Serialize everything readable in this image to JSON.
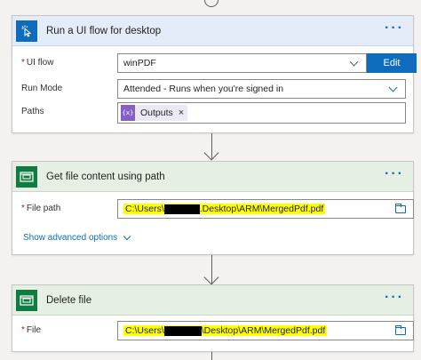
{
  "steps": [
    {
      "title": "Run a UI flow for desktop",
      "more_label": "···",
      "icon": "cursor-click-icon",
      "color": "#0f6cbd",
      "fields": {
        "ui_flow": {
          "label": "UI flow",
          "required": true,
          "value": "winPDF",
          "button": "Edit"
        },
        "run_mode": {
          "label": "Run Mode",
          "value": "Attended - Runs when you're signed in"
        },
        "paths": {
          "label": "Paths",
          "token": "Outputs",
          "token_icon": "{x}",
          "token_remove": "×"
        }
      }
    },
    {
      "title": "Get file content using path",
      "more_label": "···",
      "icon": "file-storage-icon",
      "color": "#107c41",
      "fields": {
        "file_path": {
          "label": "File path",
          "required": true,
          "value_prefix": "C:\\Users\\",
          "value_suffix": ".Desktop\\ARM\\MergedPdf.pdf"
        }
      },
      "advanced": "Show advanced options"
    },
    {
      "title": "Delete file",
      "more_label": "···",
      "icon": "file-storage-icon",
      "color": "#107c41",
      "fields": {
        "file": {
          "label": "File",
          "required": true,
          "value_prefix": "C:\\Users\\",
          "value_suffix": "\\Desktop\\ARM\\MergedPdf.pdf"
        }
      }
    }
  ],
  "required_marker": "*"
}
